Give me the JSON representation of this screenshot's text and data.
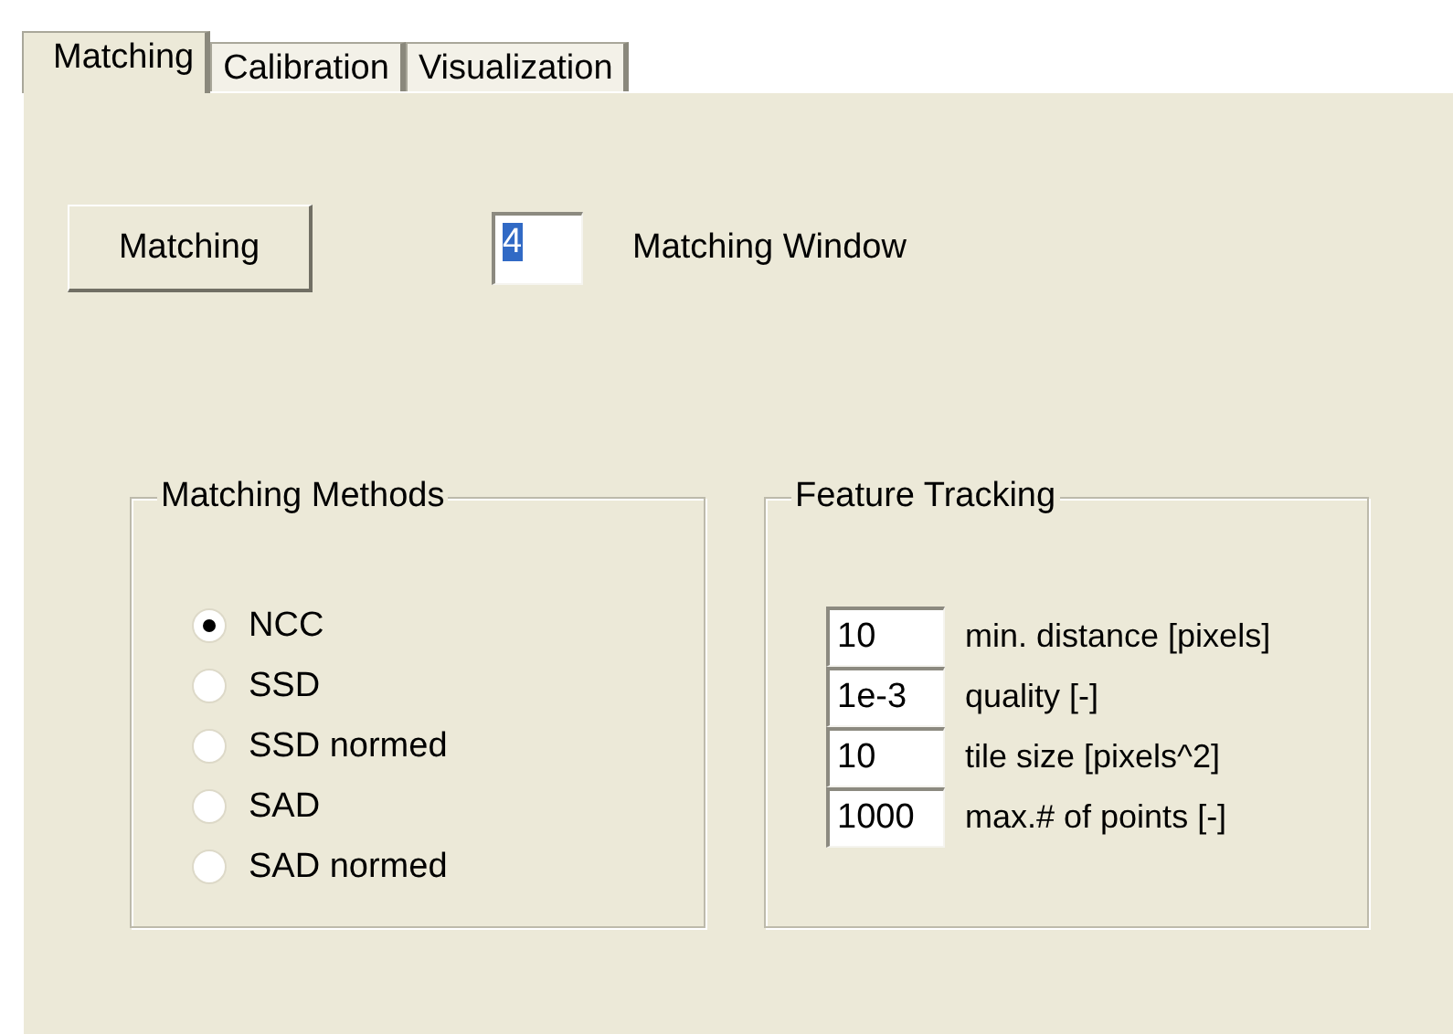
{
  "tabs": [
    {
      "label": "Matching",
      "selected": true
    },
    {
      "label": "Calibration",
      "selected": false
    },
    {
      "label": "Visualization",
      "selected": false
    }
  ],
  "match_button": {
    "label": "Matching"
  },
  "window_field": {
    "value": "4",
    "selected": true,
    "label": "Matching Window"
  },
  "methods": {
    "title": "Matching Methods",
    "options": [
      {
        "label": "NCC",
        "selected": true
      },
      {
        "label": "SSD",
        "selected": false
      },
      {
        "label": "SSD normed",
        "selected": false
      },
      {
        "label": "SAD",
        "selected": false
      },
      {
        "label": "SAD normed",
        "selected": false
      }
    ]
  },
  "tracking": {
    "title": "Feature Tracking",
    "params": [
      {
        "value": "10",
        "label": "min. distance [pixels]"
      },
      {
        "value": "1e-3",
        "label": "quality [-]"
      },
      {
        "value": "10",
        "label": "tile size [pixels^2]"
      },
      {
        "value": "1000",
        "label": "max.# of points [-]"
      }
    ]
  }
}
